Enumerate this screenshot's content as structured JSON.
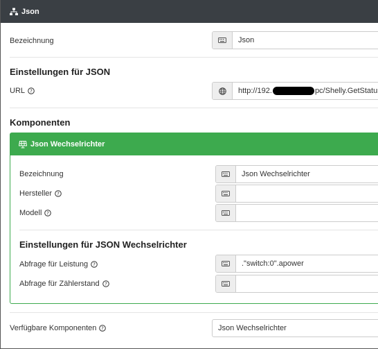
{
  "header": {
    "title": "Json"
  },
  "bezeichnung": {
    "label": "Bezeichnung",
    "value": "Json"
  },
  "json_settings": {
    "title": "Einstellungen für JSON"
  },
  "url": {
    "label": "URL",
    "value_prefix": "http://192.",
    "value_suffix": "pc/Shelly.GetStatus"
  },
  "komponenten": {
    "title": "Komponenten"
  },
  "component": {
    "title": "Json Wechselrichter",
    "bezeichnung": {
      "label": "Bezeichnung",
      "value": "Json Wechselrichter"
    },
    "hersteller": {
      "label": "Hersteller",
      "value": ""
    },
    "modell": {
      "label": "Modell",
      "value": ""
    },
    "settings_title": "Einstellungen für JSON Wechselrichter",
    "abfrage_leistung": {
      "label": "Abfrage für Leistung",
      "value": ".\"switch:0\".apower"
    },
    "abfrage_zaehler": {
      "label": "Abfrage für Zählerstand",
      "value": ""
    }
  },
  "verfuegbare": {
    "label": "Verfügbare Komponenten",
    "value": "Json Wechselrichter"
  },
  "icons": {
    "header": "sitemap-icon",
    "component": "solar-panel-icon",
    "addon": "keyboard-icon",
    "url": "globe-icon",
    "help": "question-circle-icon"
  },
  "colors": {
    "header_bg": "#3a3f44",
    "accent_green": "#3daa4e"
  }
}
